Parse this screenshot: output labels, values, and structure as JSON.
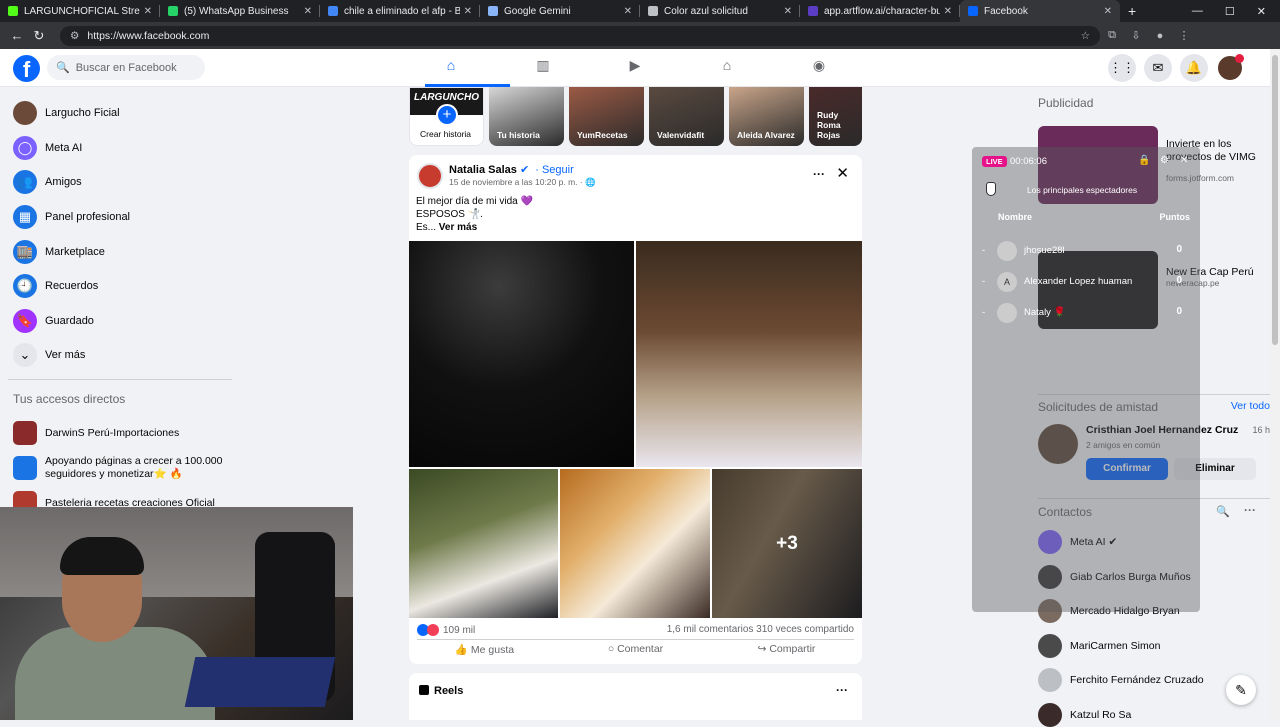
{
  "browser": {
    "tabs": [
      {
        "title": "LARGUNCHOFICIAL Stream",
        "color": "#53fc18",
        "active": false
      },
      {
        "title": "(5) WhatsApp Business",
        "color": "#25d366",
        "active": false
      },
      {
        "title": "chile a eliminado el afp - Búsqueda",
        "color": "#4285f4",
        "active": false
      },
      {
        "title": "Google Gemini",
        "color": "#8ab4f8",
        "active": false
      },
      {
        "title": "Color azul solicitud",
        "color": "#bdc1c6",
        "active": false
      },
      {
        "title": "app.artflow.ai/character-builder",
        "color": "#5b3cc4",
        "active": false
      },
      {
        "title": "Facebook",
        "color": "#0866ff",
        "active": true
      }
    ],
    "new_tab": "+",
    "url": "https://www.facebook.com"
  },
  "header": {
    "logo": "f",
    "search_placeholder": "Buscar en Facebook"
  },
  "sidebar": {
    "items": [
      {
        "label": "Largucho Ficial",
        "icon": "profile-avatar",
        "color": "#6b4a3a"
      },
      {
        "label": "Meta AI",
        "icon": "meta-ai-icon",
        "color": "#7b61ff"
      },
      {
        "label": "Amigos",
        "icon": "friends-icon",
        "color": "#1b74e4"
      },
      {
        "label": "Panel profesional",
        "icon": "dashboard-icon",
        "color": "#1b74e4"
      },
      {
        "label": "Marketplace",
        "icon": "marketplace-icon",
        "color": "#1b74e4"
      },
      {
        "label": "Recuerdos",
        "icon": "memories-icon",
        "color": "#1b74e4"
      },
      {
        "label": "Guardado",
        "icon": "saved-icon",
        "color": "#a033ff"
      },
      {
        "label": "Ver más",
        "icon": "chevron-down-icon",
        "color": "#e4e6eb"
      }
    ],
    "shortcuts_title": "Tus accesos directos",
    "shortcuts": [
      {
        "label": "DarwinS Perú-Importaciones",
        "color": "#8a2a2a"
      },
      {
        "label": "Apoyando páginas a crecer a 100.000 seguidores y monetizar⭐ 🔥",
        "color": "#1b74e4"
      },
      {
        "label": "Pasteleria recetas creaciones Oficial",
        "color": "#b03a2e"
      }
    ]
  },
  "stories": [
    {
      "label": "Crear historia",
      "banner": "LARGUNCHO"
    },
    {
      "label": "Tu historia",
      "color": "#d7d7d7"
    },
    {
      "label": "YumRecetas",
      "color": "#9b5a45"
    },
    {
      "label": "Valenvidafit",
      "color": "#5a4a40"
    },
    {
      "label": "Aleida Alvarez",
      "color": "#c9a58a"
    },
    {
      "label": "Rudy Roma Rojas",
      "color": "#4a2a2a"
    }
  ],
  "post": {
    "author": "Natalia Salas",
    "verified": "✔",
    "follow": "· Seguir",
    "date": "15 de noviembre a las 10:20 p. m. · 🌐",
    "line1": "El mejor día de mi vida 💜",
    "line2": "ESPOSOS 🤺.",
    "line3": "Es...",
    "see_more": "Ver más",
    "extra_photos": "+3",
    "reactions": "109 mil",
    "stats": "1,6 mil comentarios   310 veces compartido",
    "like": "Me gusta",
    "comment": "Comentar",
    "share": "Compartir"
  },
  "reels": {
    "title": "Reels"
  },
  "right": {
    "ads_title": "Publicidad",
    "ads": [
      {
        "title": "Invierte en los proyectos de VIMG",
        "url": "forms.jotform.com",
        "color": "#6a2a5a"
      },
      {
        "title": "New Era Cap Perú",
        "url": "neweracap.pe",
        "color": "#1b1b1b"
      }
    ],
    "friend_requests_title": "Solicitudes de amistad",
    "see_all": "Ver todo",
    "request": {
      "name": "Cristhian Joel Hernandez Cruz",
      "time": "16 h",
      "mutual": "2 amigos en común",
      "confirm": "Confirmar",
      "delete": "Eliminar"
    },
    "contacts_title": "Contactos",
    "contacts": [
      {
        "name": "Meta AI ✔",
        "color": "#7b61ff"
      },
      {
        "name": "Giab Carlos Burga Muños",
        "color": "#3a3a3a"
      },
      {
        "name": "Mercado Hidalgo Bryan",
        "color": "#7a6a60"
      },
      {
        "name": "MariCarmen Simon",
        "color": "#4a4a4a"
      },
      {
        "name": "Ferchito Fernández Cruzado",
        "color": "#bcc0c4"
      },
      {
        "name": "Katzul Ro Sa",
        "color": "#3a2a2a"
      }
    ]
  },
  "stream_overlay": {
    "live": "LIVE",
    "time": "00:06:06",
    "heading": "Los principales espectadores",
    "col_name": "Nombre",
    "col_points": "Puntos",
    "viewers": [
      {
        "name": "jhosue28l",
        "avatar": "",
        "points": "0"
      },
      {
        "name": "Alexander Lopez huaman",
        "avatar": "A",
        "points": "0"
      },
      {
        "name": "Nataly 🌹",
        "avatar": "",
        "points": "0"
      }
    ]
  }
}
